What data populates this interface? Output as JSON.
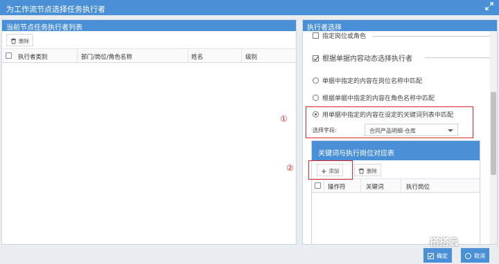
{
  "window": {
    "title": "为工作流节点选择任务执行者"
  },
  "left_panel": {
    "title": "当前节点任务执行者列表",
    "delete_label": "删除",
    "columns": [
      "执行者类别",
      "部门/岗位/角色名称",
      "姓名",
      "级别"
    ]
  },
  "right_panel": {
    "title": "执行者选择",
    "option_specified_position": "指定岗位或角色",
    "option_dynamic": "根据单据内容动态选择执行者",
    "radio_match_position": "单据中指定的内容在岗位名称中匹配",
    "radio_match_role": "根据单据中指定的内容在角色名称中匹配",
    "radio_match_keyword": "用单据中指定的内容在设定的关键词列表中匹配",
    "select_field_label": "选择字段:",
    "select_field_value": "合同产品明细-仓库",
    "markers": {
      "one": "①",
      "two": "②"
    },
    "keyword_table": {
      "title": "关键词与执行岗位对应表",
      "add_label": "添加",
      "delete_label": "删除",
      "columns": [
        "操作符",
        "关键词",
        "执行岗位"
      ]
    }
  },
  "footer": {
    "confirm_label": "确定",
    "cancel_label": "取消",
    "watermark": "搭搭云"
  }
}
